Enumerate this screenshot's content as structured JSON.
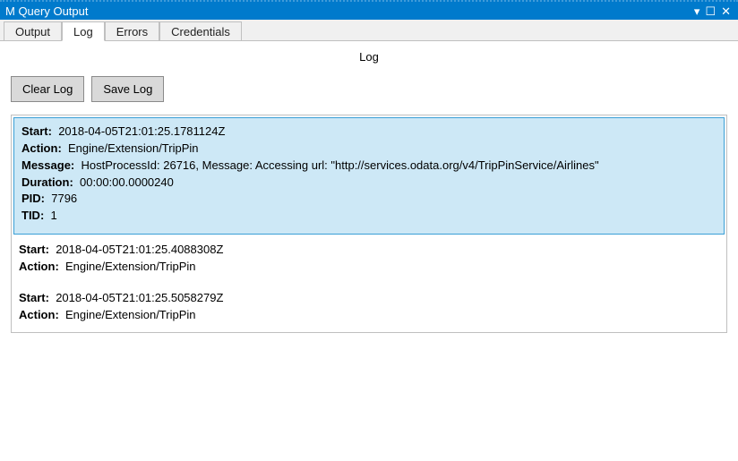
{
  "window": {
    "title": "M Query Output",
    "controls": {
      "dropdown": "▾",
      "maximize": "☐",
      "close": "✕"
    }
  },
  "tabs": [
    {
      "label": "Output",
      "active": false
    },
    {
      "label": "Log",
      "active": true
    },
    {
      "label": "Errors",
      "active": false
    },
    {
      "label": "Credentials",
      "active": false
    }
  ],
  "page": {
    "heading": "Log",
    "buttons": {
      "clear": "Clear Log",
      "save": "Save Log"
    }
  },
  "labels": {
    "start": "Start:",
    "action": "Action:",
    "message": "Message:",
    "duration": "Duration:",
    "pid": "PID:",
    "tid": "TID:"
  },
  "log_entries": [
    {
      "selected": true,
      "start": "2018-04-05T21:01:25.1781124Z",
      "action": "Engine/Extension/TripPin",
      "message": "HostProcessId: 26716, Message: Accessing url: \"http://services.odata.org/v4/TripPinService/Airlines\"",
      "duration": "00:00:00.0000240",
      "pid": "7796",
      "tid": "1"
    },
    {
      "selected": false,
      "start": "2018-04-05T21:01:25.4088308Z",
      "action": "Engine/Extension/TripPin"
    },
    {
      "selected": false,
      "start": "2018-04-05T21:01:25.5058279Z",
      "action": "Engine/Extension/TripPin"
    }
  ]
}
